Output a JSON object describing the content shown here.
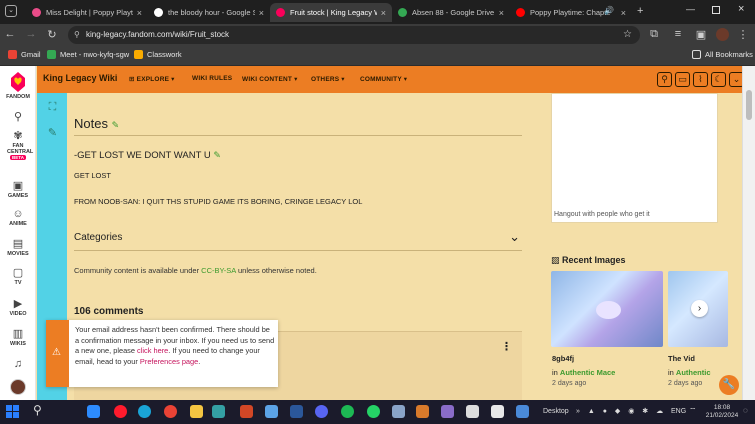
{
  "browser": {
    "tabs": [
      {
        "title": "Miss Delight | Poppy Playtim",
        "active": false,
        "favicon_color": "#ea4c89"
      },
      {
        "title": "the bloody hour - Google Se",
        "active": false,
        "favicon_color": "#ffffff"
      },
      {
        "title": "Fruit stock | King Legacy Wi",
        "active": true,
        "favicon_color": "#fa005a"
      },
      {
        "title": "Absen 88 - Google Drive",
        "active": false,
        "favicon_color": "#34a853"
      },
      {
        "title": "Poppy Playtime: Chapte",
        "active": false,
        "favicon_color": "#ff0000"
      }
    ],
    "url": "king-legacy.fandom.com/wiki/Fruit_stock",
    "bookmarks": [
      {
        "label": "Gmail",
        "color": "#ea4335"
      },
      {
        "label": "Meet - nwo-kyfq-sgw",
        "color": "#34a853"
      },
      {
        "label": "Classwork",
        "color": "#f9ab00"
      }
    ],
    "all_bookmarks_label": "All Bookmarks"
  },
  "rail": {
    "items": [
      {
        "label": "FANDOM",
        "icon": "fandom-heart-icon"
      },
      {
        "label": "",
        "icon": "search-icon"
      },
      {
        "label": "FAN CENTRAL",
        "icon": "fan-central-icon",
        "badge": "BETA"
      },
      {
        "label": "GAMES",
        "icon": "games-icon"
      },
      {
        "label": "ANIME",
        "icon": "anime-icon"
      },
      {
        "label": "MOVIES",
        "icon": "movies-icon"
      },
      {
        "label": "TV",
        "icon": "tv-icon"
      },
      {
        "label": "VIDEO",
        "icon": "video-icon"
      },
      {
        "label": "WIKIS",
        "icon": "wikis-icon"
      }
    ]
  },
  "wiki": {
    "name": "King Legacy Wiki",
    "nav": [
      {
        "label": "EXPLORE",
        "dropdown": true
      },
      {
        "label": "WIKI RULES",
        "dropdown": false
      },
      {
        "label": "WIKI CONTENT",
        "dropdown": true
      },
      {
        "label": "OTHERS",
        "dropdown": true
      },
      {
        "label": "COMMUNITY",
        "dropdown": true
      }
    ],
    "accent": "#ec7d23"
  },
  "content": {
    "notes_heading": "Notes",
    "subheading": "-GET LOST WE DONT WANT U",
    "para1": "GET LOST",
    "para2": "FROM NOOB-SAN: I QUIT THS STUPID GAME ITS BORING, CRINGE LEGACY LOL",
    "categories_label": "Categories",
    "license_prefix": "Community content is available under ",
    "license_link": "CC-BY-SA",
    "license_suffix": " unless otherwise noted.",
    "comments_count": "106 comments"
  },
  "notice": {
    "part1": "Your email address hasn't been confirmed. There should be a confirmation message in your inbox. If you need us to send a new one, please ",
    "link1": "click here",
    "part2": ". If you need to change your email, head to your ",
    "link2": "Preferences page",
    "part3": "."
  },
  "sidebar": {
    "ad_caption": "Hangout with people who get it",
    "recent_images_title": "Recent Images",
    "images": [
      {
        "name": "8gb4fj",
        "in_label": "in ",
        "link": "Authentic Mace",
        "time": "2 days ago"
      },
      {
        "name": "The Vid",
        "in_label": "in ",
        "link": "Authentic",
        "time": "2 days ago"
      }
    ]
  },
  "taskbar": {
    "desktop_label": "Desktop",
    "lang": "ENG",
    "time": "18:08",
    "date": "21/02/2024"
  }
}
